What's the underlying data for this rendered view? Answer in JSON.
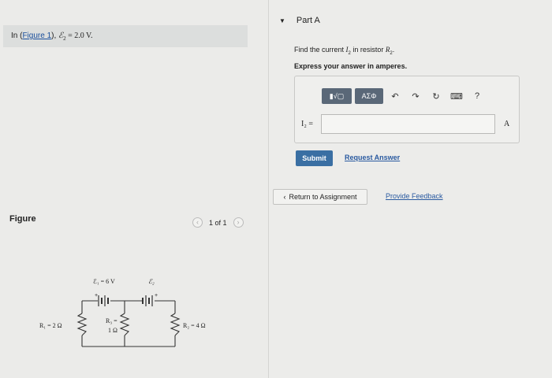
{
  "intro": {
    "prefix": "In (",
    "figure_link": "Figure 1",
    "suffix": "),",
    "emf_symbol": "ℰ",
    "emf_sub": "2",
    "equation": " = 2.0 V."
  },
  "figure": {
    "label": "Figure",
    "pager_text": "1 of 1",
    "prev": "‹",
    "next": "›"
  },
  "circuit": {
    "e1_label": "ℰ₁ = 6 V",
    "e2_label": "ℰ₂",
    "r1_label": "R₁ = 2 Ω",
    "r3_label_top": "R₃ =",
    "r3_label_bottom": "1 Ω",
    "r2_label": "R₂ = 4 Ω",
    "plus": "+"
  },
  "part": {
    "caret": "▼",
    "title": "Part A",
    "question_prefix": "Find the current ",
    "current_symbol": "I",
    "current_sub": "2",
    "question_mid": " in resistor ",
    "resistor_symbol": "R",
    "resistor_sub": "2",
    "question_suffix": ".",
    "instruction": "Express your answer in amperes."
  },
  "toolbar": {
    "template_btn": "▮√▢",
    "symbols_btn": "ΑΣΦ",
    "undo": "↶",
    "redo": "↷",
    "reset": "↻",
    "keyboard": "⌨",
    "help": "?"
  },
  "answer": {
    "label": "I₂ =",
    "value": "",
    "unit": "A"
  },
  "actions": {
    "submit": "Submit",
    "request": "Request Answer",
    "return": "Return to Assignment",
    "return_icon": "‹",
    "feedback": "Provide Feedback"
  }
}
